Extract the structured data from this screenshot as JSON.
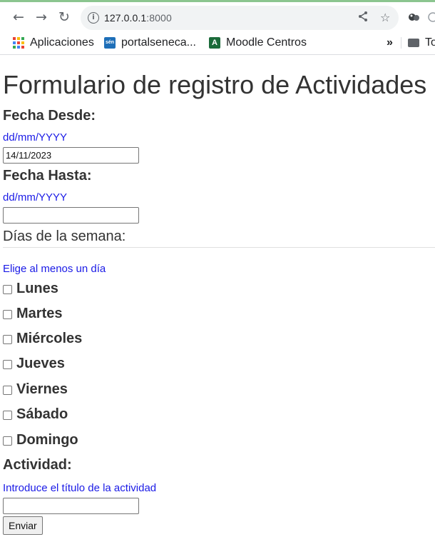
{
  "browser": {
    "url_host": "127.0.0.1",
    "url_port": ":8000",
    "bookmarks": [
      {
        "label": "Aplicaciones",
        "icon": "apps-grid-icon"
      },
      {
        "label": "portalseneca...",
        "icon": "seneca-icon"
      },
      {
        "label": "Moodle Centros",
        "icon": "moodle-icon"
      }
    ],
    "overflow_label": "»",
    "folder_label": "To"
  },
  "form": {
    "title": "Formulario de registro de Actividades",
    "fecha_desde_label": "Fecha Desde:",
    "fecha_desde_hint": "dd/mm/YYYY",
    "fecha_desde_value": "14/11/2023",
    "fecha_hasta_label": "Fecha Hasta:",
    "fecha_hasta_hint": "dd/mm/YYYY",
    "fecha_hasta_value": "",
    "dias_legend": "Días de la semana:",
    "dias_hint": "Elige al menos un día",
    "days": [
      "Lunes",
      "Martes",
      "Miércoles",
      "Jueves",
      "Viernes",
      "Sábado",
      "Domingo"
    ],
    "actividad_label": "Actividad:",
    "actividad_hint": "Introduce el título de la actividad",
    "actividad_value": "",
    "submit_label": "Enviar"
  },
  "colors": {
    "hint": "#1a1ae6",
    "text": "#333333",
    "tab_strip": "#8bc58f"
  }
}
